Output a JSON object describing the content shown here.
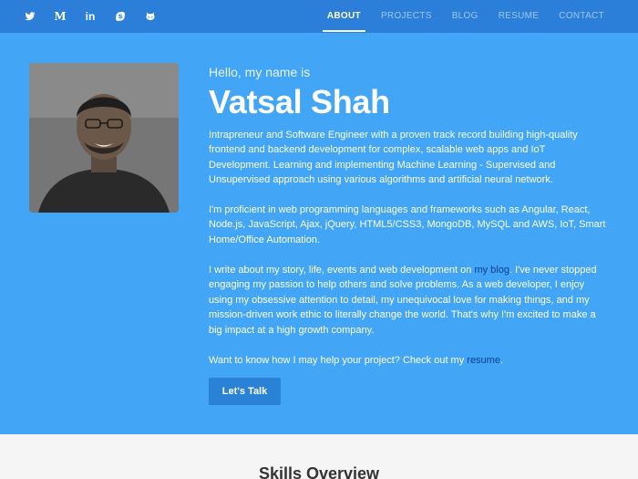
{
  "nav": {
    "social": [
      {
        "icon": "twitter-icon"
      },
      {
        "icon": "medium-icon",
        "glyph": "M"
      },
      {
        "icon": "linkedin-icon",
        "glyph": "in"
      },
      {
        "icon": "skype-icon"
      },
      {
        "icon": "github-icon"
      }
    ],
    "menu": [
      {
        "label": "ABOUT",
        "active": true
      },
      {
        "label": "PROJECTS"
      },
      {
        "label": "BLOG"
      },
      {
        "label": "RESUME"
      },
      {
        "label": "CONTACT"
      }
    ]
  },
  "hero": {
    "greeting": "Hello, my name is",
    "name": "Vatsal Shah",
    "paragraph1": "Intrapreneur and Software Engineer with a proven track record building high-quality frontend and backend development for complex, scalable web apps and IoT Development. Learning and implementing Machine Learning - Supervised and Unsupervised approach using various algorithms and artificial neural network.",
    "paragraph2": "I'm proficient in web programming languages and frameworks such as Angular, React, Node.js, JavaScript, Ajax, jQuery, HTML5/CSS3, MongoDB, MySQL and AWS, IoT, Smart Home/Office Automation.",
    "paragraph3_before": "I write about my story, life, events and web development on ",
    "paragraph3_link": "my blog",
    "paragraph3_after": ". I've never stopped engaging my passion to help others and solve problems. As a web developer, I enjoy using my obsessive attention to detail, my unequivocal love for making things, and my mission-driven work ethic to literally change the world. That's why I'm excited to make a big impact at a high growth company.",
    "paragraph4_before": "Want to know how I may help your project? Check out my ",
    "paragraph4_link": "resume",
    "paragraph4_after": ".",
    "cta": "Let's Talk"
  },
  "skills": {
    "title": "Skills Overview"
  },
  "colors": {
    "nav": "#2b7fd8",
    "hero": "#42a5f5",
    "link": "#0d3d8f",
    "button": "#2a82d6"
  }
}
